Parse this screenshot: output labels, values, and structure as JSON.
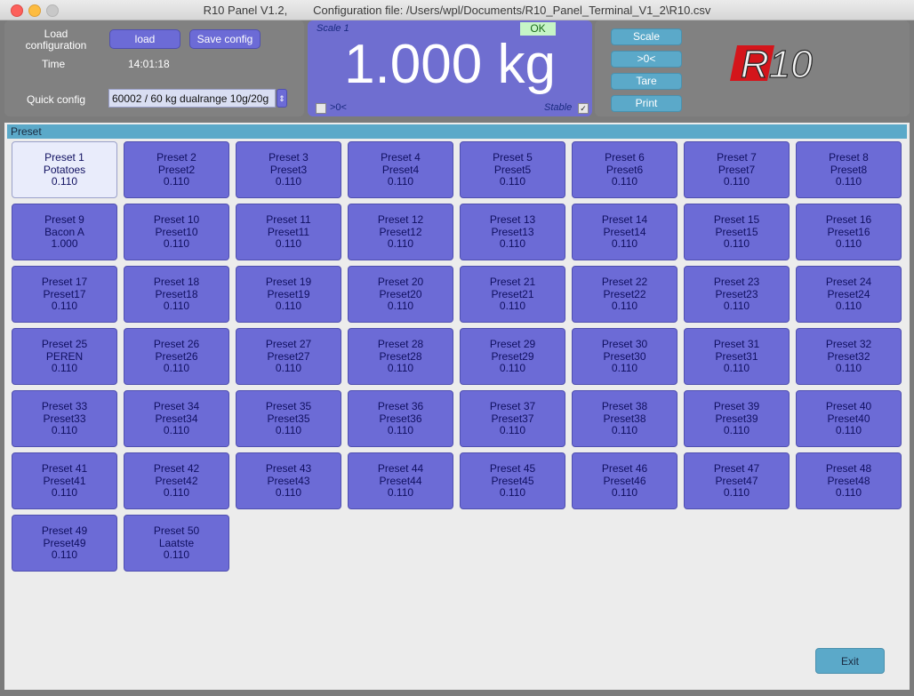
{
  "window": {
    "title": "R10 Panel V1.2,        Configuration file: /Users/wpl/Documents/R10_Panel_Terminal_V1_2\\R10.csv"
  },
  "left_panel": {
    "load_configuration_label": "Load configuration",
    "load_button": "load",
    "save_button": "Save config",
    "time_label": "Time",
    "time_value": "14:01:18",
    "quick_config_label": "Quick config",
    "quick_config_value": "60002  / 60 kg dualrange 10g/20g",
    "quick_config_arrow": "⇕"
  },
  "scale_panel": {
    "scale_name": "Scale 1",
    "status": "OK",
    "weight": "1.000 kg",
    "zero_label": ">0<",
    "zero_checked": false,
    "stable_label": "Stable",
    "stable_checked": true,
    "stable_mark": "✓"
  },
  "right_panel": {
    "buttons": [
      "Scale",
      ">0<",
      "Tare",
      "Print"
    ],
    "logo_text": "R10"
  },
  "preset_section": {
    "header": "Preset",
    "presets": [
      {
        "line1": "Preset 1",
        "line2": "Potatoes",
        "value": "0.110",
        "selected": true
      },
      {
        "line1": "Preset 2",
        "line2": "Preset2",
        "value": "0.110"
      },
      {
        "line1": "Preset 3",
        "line2": "Preset3",
        "value": "0.110"
      },
      {
        "line1": "Preset 4",
        "line2": "Preset4",
        "value": "0.110"
      },
      {
        "line1": "Preset 5",
        "line2": "Preset5",
        "value": "0.110"
      },
      {
        "line1": "Preset 6",
        "line2": "Preset6",
        "value": "0.110"
      },
      {
        "line1": "Preset 7",
        "line2": "Preset7",
        "value": "0.110"
      },
      {
        "line1": "Preset 8",
        "line2": "Preset8",
        "value": "0.110"
      },
      {
        "line1": "Preset 9",
        "line2": "Bacon A",
        "value": "1.000"
      },
      {
        "line1": "Preset 10",
        "line2": "Preset10",
        "value": "0.110"
      },
      {
        "line1": "Preset 11",
        "line2": "Preset11",
        "value": "0.110"
      },
      {
        "line1": "Preset 12",
        "line2": "Preset12",
        "value": "0.110"
      },
      {
        "line1": "Preset 13",
        "line2": "Preset13",
        "value": "0.110"
      },
      {
        "line1": "Preset 14",
        "line2": "Preset14",
        "value": "0.110"
      },
      {
        "line1": "Preset 15",
        "line2": "Preset15",
        "value": "0.110"
      },
      {
        "line1": "Preset 16",
        "line2": "Preset16",
        "value": "0.110"
      },
      {
        "line1": "Preset 17",
        "line2": "Preset17",
        "value": "0.110"
      },
      {
        "line1": "Preset 18",
        "line2": "Preset18",
        "value": "0.110"
      },
      {
        "line1": "Preset 19",
        "line2": "Preset19",
        "value": "0.110"
      },
      {
        "line1": "Preset 20",
        "line2": "Preset20",
        "value": "0.110"
      },
      {
        "line1": "Preset 21",
        "line2": "Preset21",
        "value": "0.110"
      },
      {
        "line1": "Preset 22",
        "line2": "Preset22",
        "value": "0.110"
      },
      {
        "line1": "Preset 23",
        "line2": "Preset23",
        "value": "0.110"
      },
      {
        "line1": "Preset 24",
        "line2": "Preset24",
        "value": "0.110"
      },
      {
        "line1": "Preset 25",
        "line2": "PEREN",
        "value": "0.110"
      },
      {
        "line1": "Preset 26",
        "line2": "Preset26",
        "value": "0.110"
      },
      {
        "line1": "Preset 27",
        "line2": "Preset27",
        "value": "0.110"
      },
      {
        "line1": "Preset 28",
        "line2": "Preset28",
        "value": "0.110"
      },
      {
        "line1": "Preset 29",
        "line2": "Preset29",
        "value": "0.110"
      },
      {
        "line1": "Preset 30",
        "line2": "Preset30",
        "value": "0.110"
      },
      {
        "line1": "Preset 31",
        "line2": "Preset31",
        "value": "0.110"
      },
      {
        "line1": "Preset 32",
        "line2": "Preset32",
        "value": "0.110"
      },
      {
        "line1": "Preset 33",
        "line2": "Preset33",
        "value": "0.110"
      },
      {
        "line1": "Preset 34",
        "line2": "Preset34",
        "value": "0.110"
      },
      {
        "line1": "Preset 35",
        "line2": "Preset35",
        "value": "0.110"
      },
      {
        "line1": "Preset 36",
        "line2": "Preset36",
        "value": "0.110"
      },
      {
        "line1": "Preset 37",
        "line2": "Preset37",
        "value": "0.110"
      },
      {
        "line1": "Preset 38",
        "line2": "Preset38",
        "value": "0.110"
      },
      {
        "line1": "Preset 39",
        "line2": "Preset39",
        "value": "0.110"
      },
      {
        "line1": "Preset 40",
        "line2": "Preset40",
        "value": "0.110"
      },
      {
        "line1": "Preset 41",
        "line2": "Preset41",
        "value": "0.110"
      },
      {
        "line1": "Preset 42",
        "line2": "Preset42",
        "value": "0.110"
      },
      {
        "line1": "Preset 43",
        "line2": "Preset43",
        "value": "0.110"
      },
      {
        "line1": "Preset 44",
        "line2": "Preset44",
        "value": "0.110"
      },
      {
        "line1": "Preset 45",
        "line2": "Preset45",
        "value": "0.110"
      },
      {
        "line1": "Preset 46",
        "line2": "Preset46",
        "value": "0.110"
      },
      {
        "line1": "Preset 47",
        "line2": "Preset47",
        "value": "0.110"
      },
      {
        "line1": "Preset 48",
        "line2": "Preset48",
        "value": "0.110"
      },
      {
        "line1": "Preset 49",
        "line2": "Preset49",
        "value": "0.110"
      },
      {
        "line1": "Preset 50",
        "line2": "Laatste",
        "value": "0.110"
      }
    ]
  },
  "footer": {
    "exit_button": "Exit"
  },
  "colors": {
    "button_purple": "#6c6bd6",
    "scale_panel": "#6f6ed0",
    "accent_blue": "#5ba9c9",
    "panel_gray": "#818181"
  }
}
